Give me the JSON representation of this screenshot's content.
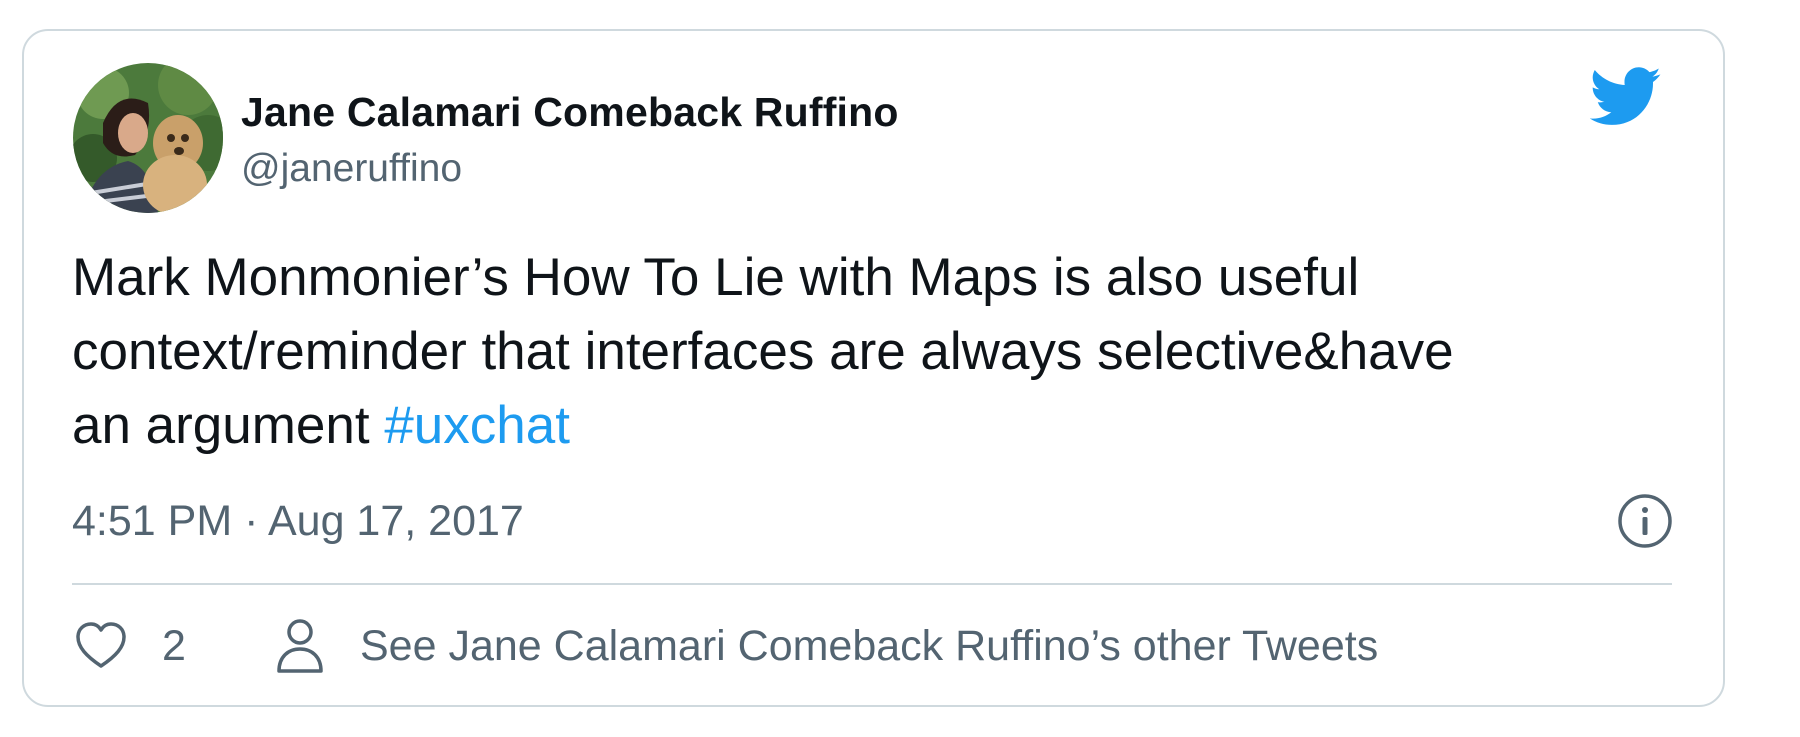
{
  "tweet": {
    "author": {
      "name": "Jane Calamari Comeback Ruffino",
      "handle": "@janeruffino"
    },
    "text": {
      "line1": "Mark Monmonier’s How To Lie with Maps is also useful",
      "line2": "context/reminder that interfaces are always selective&have",
      "line3": "an argument ",
      "hashtag": "#uxchat"
    },
    "timestamp": "4:51 PM · Aug 17, 2017",
    "actions": {
      "like_count": "2",
      "other_tweets_label": "See Jane Calamari Comeback Ruffino’s other Tweets"
    }
  },
  "icons": {
    "logo": "twitter-bird-icon",
    "info": "info-icon",
    "like": "heart-icon",
    "profile": "person-icon"
  },
  "colors": {
    "brand": "#1d9bf0",
    "text_primary": "#0f1419",
    "text_secondary": "#536471",
    "border": "#cfd9de"
  }
}
